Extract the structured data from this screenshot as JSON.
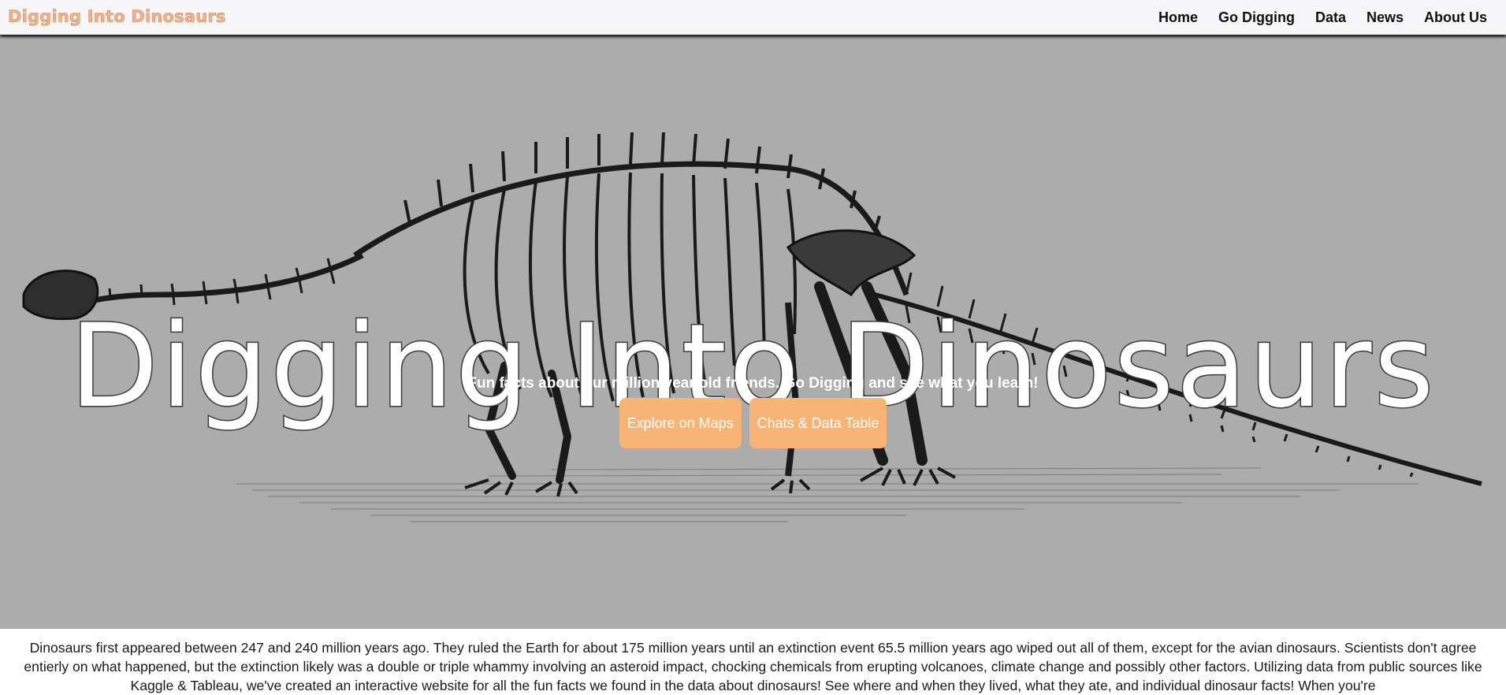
{
  "navbar": {
    "brand": "Digging Into Dinosaurs",
    "links": [
      {
        "label": "Home"
      },
      {
        "label": "Go Digging"
      },
      {
        "label": "Data"
      },
      {
        "label": "News"
      },
      {
        "label": "About Us"
      }
    ]
  },
  "hero": {
    "title": "Digging Into Dinosaurs",
    "subtitle": "Fun facts about our million year old friends. Go Digging and see what you learn!",
    "buttons": [
      {
        "label": "Explore on Maps"
      },
      {
        "label": "Chats & Data Table"
      }
    ],
    "background_image": "sauropod-skeleton-sketch"
  },
  "intro": {
    "text": "Dinosaurs first appeared between 247 and 240 million years ago. They ruled the Earth for about 175 million years until an extinction event 65.5 million years ago wiped out all of them, except for the avian dinosaurs. Scientists don't agree entierly on what happened, but the extinction likely was a double or triple whammy involving an asteroid impact, chocking chemicals from erupting volcanoes, climate change and possibly other factors. Utilizing data from public sources like Kaggle & Tableau, we've created an interactive website for all the fun facts we found in the data about dinosaurs! See where and when they lived, what they ate, and individual dinosaur facts! When you're"
  },
  "colors": {
    "navbar_bg": "#f6f6f8",
    "brand": "#f0b48a",
    "hero_bg": "#acacac",
    "button_bg": "#f8b476",
    "button_text": "#ffffff"
  }
}
